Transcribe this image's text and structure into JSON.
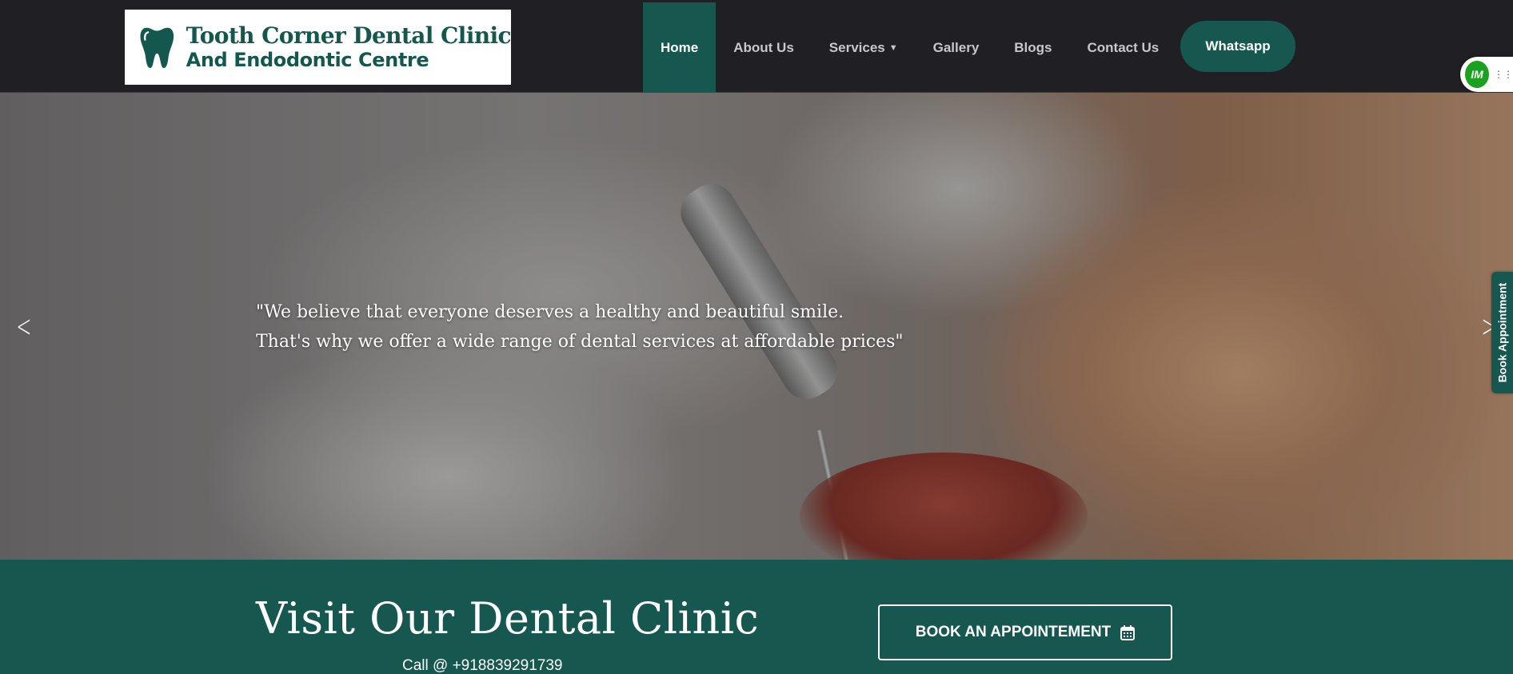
{
  "logo": {
    "line1": "Tooth Corner Dental Clinic",
    "line2": "And Endodontic Centre",
    "icon": "tooth-icon",
    "color": "#14574f"
  },
  "nav": {
    "items": [
      {
        "label": "Home",
        "active": true
      },
      {
        "label": "About Us"
      },
      {
        "label": "Services",
        "has_dropdown": true
      },
      {
        "label": "Gallery"
      },
      {
        "label": "Blogs"
      },
      {
        "label": "Contact Us"
      }
    ],
    "whatsapp_label": "Whatsapp",
    "chevron_icon": "chevron-down-icon"
  },
  "widget": {
    "label": "IM"
  },
  "hero": {
    "quote_line1": "\"We believe that everyone deserves a healthy and beautiful smile.",
    "quote_line2": "That's why we offer a wide range of dental services at affordable prices\"",
    "prev_icon": "chevron-left-icon",
    "next_icon": "chevron-right-icon"
  },
  "side_tab": {
    "label": "Book Appointment"
  },
  "band": {
    "heading": "Visit Our Dental Clinic",
    "call": "Call @ +918839291739",
    "book_label": "BOOK AN APPOINTEMENT",
    "book_icon": "calendar-icon"
  },
  "colors": {
    "header_bg": "#1f1f24",
    "accent": "#16574f",
    "text_light": "#ffffff",
    "widget_green": "#19a11f"
  }
}
